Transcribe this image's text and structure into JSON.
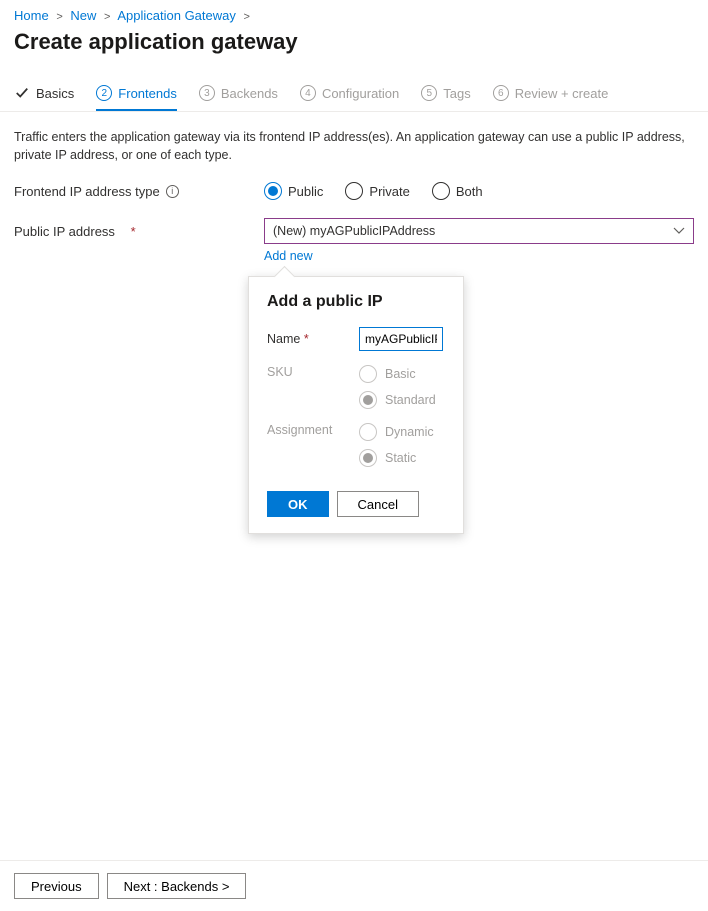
{
  "breadcrumb": {
    "home": "Home",
    "new": "New",
    "appgw": "Application Gateway"
  },
  "page_title": "Create application gateway",
  "tabs": {
    "basics": "Basics",
    "frontends": {
      "num": "2",
      "label": "Frontends"
    },
    "backends": {
      "num": "3",
      "label": "Backends"
    },
    "configuration": {
      "num": "4",
      "label": "Configuration"
    },
    "tags": {
      "num": "5",
      "label": "Tags"
    },
    "review": {
      "num": "6",
      "label": "Review + create"
    }
  },
  "description": "Traffic enters the application gateway via its frontend IP address(es). An application gateway can use a public IP address, private IP address, or one of each type.",
  "labels": {
    "frontend_type": "Frontend IP address type",
    "public_ip": "Public IP address"
  },
  "radios": {
    "public": "Public",
    "private": "Private",
    "both": "Both"
  },
  "select_value": "(New) myAGPublicIPAddress",
  "add_new": "Add new",
  "popover": {
    "title": "Add a public IP",
    "name_label": "Name",
    "name_value": "myAGPublicIPAddress",
    "sku_label": "SKU",
    "sku_basic": "Basic",
    "sku_standard": "Standard",
    "assign_label": "Assignment",
    "assign_dynamic": "Dynamic",
    "assign_static": "Static",
    "ok": "OK",
    "cancel": "Cancel"
  },
  "footer": {
    "prev": "Previous",
    "next": "Next : Backends >"
  }
}
